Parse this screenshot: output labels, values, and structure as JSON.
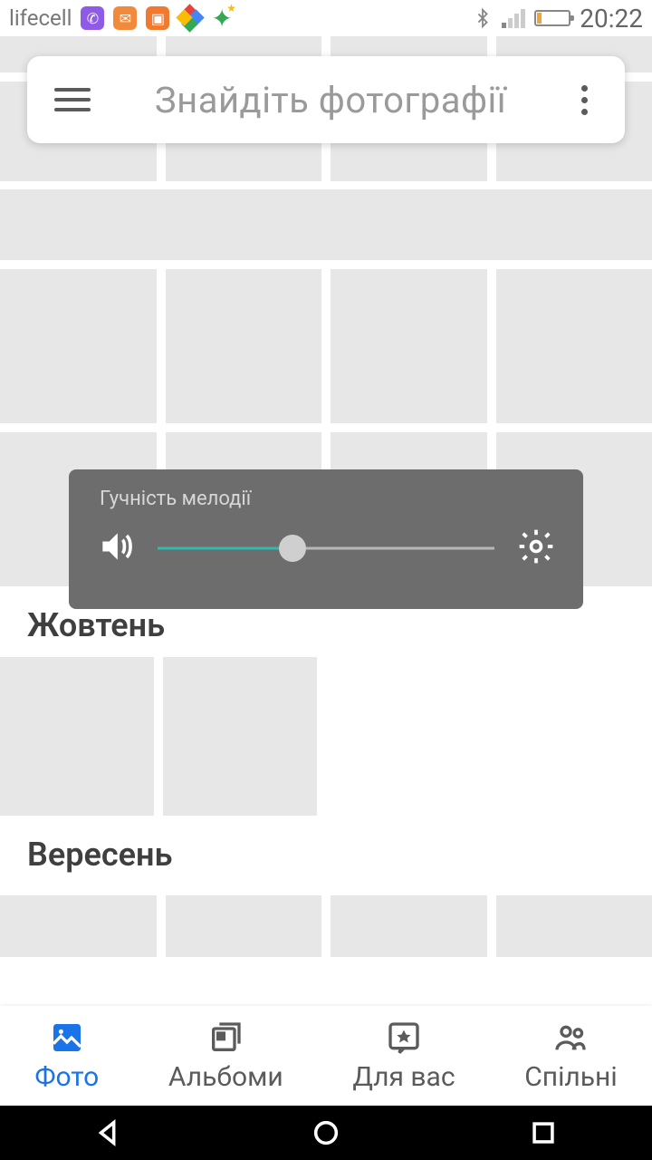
{
  "statusbar": {
    "carrier": "lifecell",
    "time": "20:22"
  },
  "search": {
    "placeholder": "Знайдіть фотографії"
  },
  "volume": {
    "label": "Гучність мелодії",
    "percent": 40
  },
  "sections": {
    "october": "Жовтень",
    "september": "Вересень"
  },
  "tabs": {
    "photos": "Фото",
    "albums": "Альбоми",
    "for_you": "Для вас",
    "shared": "Спільні"
  }
}
